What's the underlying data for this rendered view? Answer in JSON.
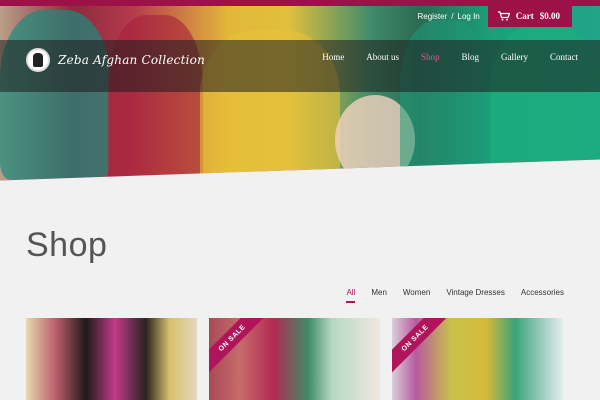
{
  "header": {
    "brand": "Zeba Afghan Collection",
    "account": {
      "register": "Register",
      "separator": "/",
      "login": "Log In"
    },
    "cart": {
      "label": "Cart",
      "total": "$0.00",
      "icon": "cart-icon"
    },
    "nav": [
      {
        "label": "Home",
        "active": false
      },
      {
        "label": "About us",
        "active": false
      },
      {
        "label": "Shop",
        "active": true
      },
      {
        "label": "Blog",
        "active": false
      },
      {
        "label": "Gallery",
        "active": false
      },
      {
        "label": "Contact",
        "active": false
      }
    ]
  },
  "main": {
    "title": "Shop",
    "filters": [
      {
        "label": "All",
        "active": true
      },
      {
        "label": "Men",
        "active": false
      },
      {
        "label": "Women",
        "active": false
      },
      {
        "label": "Vintage Dresses",
        "active": false
      },
      {
        "label": "Accessories",
        "active": false
      }
    ],
    "products": [
      {
        "badge": ""
      },
      {
        "badge": "ON SALE"
      },
      {
        "badge": "ON SALE"
      }
    ]
  },
  "colors": {
    "accent": "#b0145a",
    "cart_bg": "#9c1248",
    "page_bg": "#f1f1f1"
  }
}
